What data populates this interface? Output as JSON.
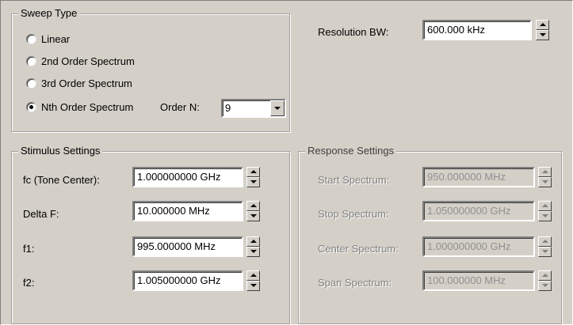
{
  "sweep_type": {
    "title": "Sweep Type",
    "options": [
      {
        "label": "Linear",
        "selected": false
      },
      {
        "label": "2nd Order Spectrum",
        "selected": false
      },
      {
        "label": "3rd Order Spectrum",
        "selected": false
      },
      {
        "label": "Nth Order Spectrum",
        "selected": true
      }
    ],
    "order_label": "Order N:",
    "order_value": "9"
  },
  "resolution_bw": {
    "label": "Resolution BW:",
    "value": "600.000 kHz"
  },
  "stimulus": {
    "title": "Stimulus Settings",
    "fields": [
      {
        "label": "fc (Tone Center):",
        "value": "1.000000000 GHz"
      },
      {
        "label": "Delta F:",
        "value": "10.000000 MHz"
      },
      {
        "label": "f1:",
        "value": "995.000000 MHz"
      },
      {
        "label": "f2:",
        "value": "1.005000000 GHz"
      }
    ]
  },
  "response": {
    "title": "Response Settings",
    "enabled": false,
    "fields": [
      {
        "label": "Start Spectrum:",
        "value": "950.000000 MHz"
      },
      {
        "label": "Stop Spectrum:",
        "value": "1.050000000 GHz"
      },
      {
        "label": "Center Spectrum:",
        "value": "1.000000000 GHz"
      },
      {
        "label": "Span Spectrum:",
        "value": "100.000000 MHz"
      }
    ]
  }
}
